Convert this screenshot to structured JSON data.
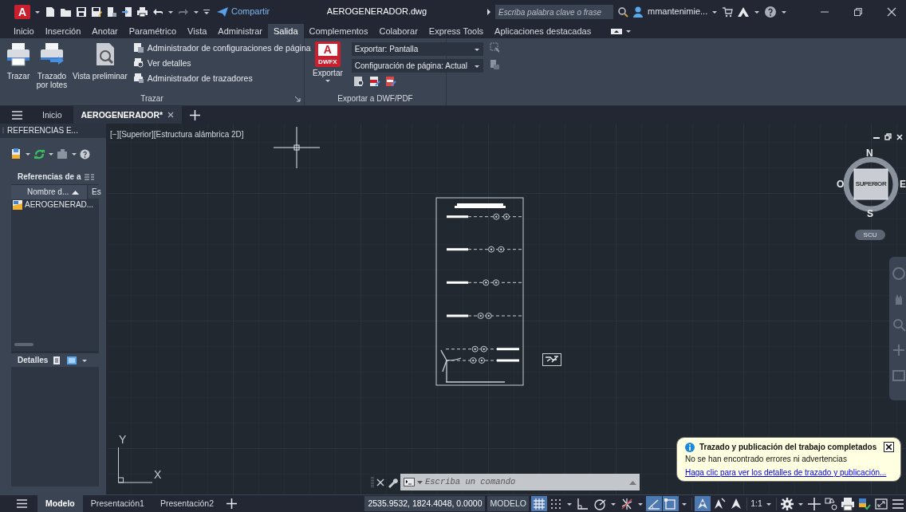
{
  "title_bar": {
    "logo": "A",
    "share": "Compartir",
    "document_title": "AEROGENERADOR.dwg",
    "search_placeholder": "Escriba palabra clave o frase",
    "user": "mmantenimie..."
  },
  "ribbon_tabs": [
    {
      "label": "Inicio",
      "selected": false
    },
    {
      "label": "Inserción",
      "selected": false
    },
    {
      "label": "Anotar",
      "selected": false
    },
    {
      "label": "Paramétrico",
      "selected": false
    },
    {
      "label": "Vista",
      "selected": false
    },
    {
      "label": "Administrar",
      "selected": false
    },
    {
      "label": "Salida",
      "selected": true
    },
    {
      "label": "Complementos",
      "selected": false
    },
    {
      "label": "Colaborar",
      "selected": false
    },
    {
      "label": "Express Tools",
      "selected": false
    },
    {
      "label": "Aplicaciones destacadas",
      "selected": false
    }
  ],
  "ribbon": {
    "plot_panel": {
      "big_buttons": [
        {
          "kind": "plot",
          "label": "Trazar"
        },
        {
          "kind": "batch",
          "label": "Trazado por lotes"
        },
        {
          "kind": "preview",
          "label": "Vista preliminar"
        }
      ],
      "commands": [
        "Administrador de configuraciones de página",
        "Ver detalles",
        "Administrador de trazadores"
      ],
      "title": "Trazar"
    },
    "export_panel": {
      "button": "Exportar",
      "button_icon_letter": "A",
      "button_icon_text": "DWFX",
      "dropdowns": [
        "Exportar: Pantalla",
        "Configuración de página: Actual"
      ],
      "title": "Exportar a DWF/PDF"
    }
  },
  "file_tabs": [
    {
      "label": "Inicio",
      "selected": false
    },
    {
      "label": "AEROGENERADOR*",
      "selected": true
    }
  ],
  "xref_palette": {
    "title": "REFERENCIAS E...",
    "section": "Referencias de a",
    "column_1": "Nombre d...",
    "column_2": "Es",
    "items": [
      "AEROGENERAD..."
    ],
    "details": "Detalles"
  },
  "viewport": {
    "label": "[−][Superior][Estructura alámbrica 2D]",
    "viewcube": {
      "north": "N",
      "south": "S",
      "east": "E",
      "west": "O",
      "face": "SUPERIOR",
      "ucs": "SCU"
    },
    "ucs_y": "Y",
    "ucs_x": "X"
  },
  "command_line": {
    "placeholder": "Escriba un comando"
  },
  "notification": {
    "title": "Trazado y publicación del trabajo completados",
    "message": "No se han encontrado errores ni advertencias",
    "link": "Haga clic para ver los detalles de trazado y publicación..."
  },
  "layout_tabs": [
    {
      "label": "Modelo",
      "selected": true
    },
    {
      "label": "Presentación1",
      "selected": false
    },
    {
      "label": "Presentación2",
      "selected": false
    }
  ],
  "status_bar": {
    "coordinates": "2535.9532, 1824.4048, 0.0000",
    "space": "MODELO",
    "items": [
      {
        "kind": "grid",
        "on": true
      },
      {
        "kind": "snap",
        "on": false,
        "menu": true
      },
      {
        "kind": "ortho",
        "on": false
      },
      {
        "kind": "polar",
        "on": false,
        "menu": true
      },
      {
        "kind": "isodraft",
        "on": false,
        "menu": true
      },
      {
        "kind": "track",
        "on": true
      },
      {
        "kind": "osnap",
        "on": true,
        "menu": true
      },
      {
        "kind": "annotation",
        "on": true
      },
      {
        "kind": "autoscale",
        "on": false
      },
      {
        "kind": "annoscale",
        "on": false
      },
      {
        "kind": "scale",
        "label": "1:1",
        "menu": true
      },
      {
        "kind": "gear",
        "menu": true
      },
      {
        "kind": "plus"
      },
      {
        "kind": "properties"
      },
      {
        "kind": "plotter"
      },
      {
        "kind": "isolate"
      },
      {
        "kind": "fullscreen"
      },
      {
        "kind": "menu"
      }
    ]
  }
}
